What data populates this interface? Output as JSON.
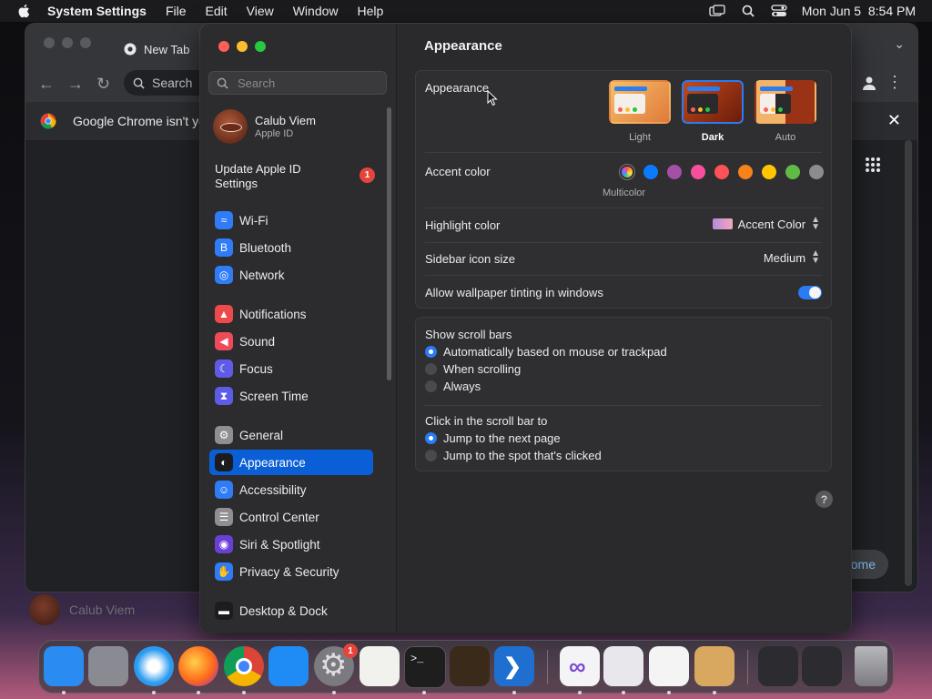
{
  "menubar": {
    "apple_icon": "apple-logo-icon",
    "app_name": "System Settings",
    "menus": [
      "File",
      "Edit",
      "View",
      "Window",
      "Help"
    ],
    "status_icons": [
      "display-mirror-icon",
      "search-icon",
      "control-center-icon"
    ],
    "clock": "Mon Jun 5  8:54 PM"
  },
  "chrome": {
    "tab_title": "New Tab",
    "omnibox_placeholder": "Search",
    "infobar_text": "Google Chrome isn't yo",
    "home_button": "ome",
    "profile_name": "Calub Viem"
  },
  "settings": {
    "search_placeholder": "Search",
    "account": {
      "name": "Calub Viem",
      "subtitle": "Apple ID"
    },
    "update": {
      "label": "Update Apple ID Settings",
      "badge": "1"
    },
    "sidebar": [
      {
        "label": "Wi-Fi",
        "icon": "wifi-icon",
        "color": "#2f7cf6"
      },
      {
        "label": "Bluetooth",
        "icon": "bluetooth-icon",
        "color": "#2f7cf6"
      },
      {
        "label": "Network",
        "icon": "globe-icon",
        "color": "#2f7cf6"
      },
      {
        "label": "Notifications",
        "icon": "bell-icon",
        "color": "#ee4a4a"
      },
      {
        "label": "Sound",
        "icon": "speaker-icon",
        "color": "#ee4a5a"
      },
      {
        "label": "Focus",
        "icon": "moon-icon",
        "color": "#5e5ce6"
      },
      {
        "label": "Screen Time",
        "icon": "hourglass-icon",
        "color": "#5e5ce6"
      },
      {
        "label": "General",
        "icon": "gear-icon",
        "color": "#8e8e93"
      },
      {
        "label": "Appearance",
        "icon": "appearance-icon",
        "color": "#1c1c1e"
      },
      {
        "label": "Accessibility",
        "icon": "accessibility-icon",
        "color": "#2f7cf6"
      },
      {
        "label": "Control Center",
        "icon": "control-center-icon",
        "color": "#8e8e93"
      },
      {
        "label": "Siri & Spotlight",
        "icon": "siri-icon",
        "color": "#6a3fd6"
      },
      {
        "label": "Privacy & Security",
        "icon": "hand-icon",
        "color": "#2f7cf6"
      },
      {
        "label": "Desktop & Dock",
        "icon": "dock-icon",
        "color": "#1c1c1e"
      }
    ],
    "active_item": "Appearance",
    "title": "Appearance",
    "appearance": {
      "label": "Appearance",
      "options": [
        {
          "label": "Light",
          "selected": false
        },
        {
          "label": "Dark",
          "selected": true
        },
        {
          "label": "Auto",
          "selected": false
        }
      ]
    },
    "accent": {
      "label": "Accent color",
      "selected_name": "Multicolor",
      "colors": [
        "multicolor",
        "#0a7aff",
        "#a550a7",
        "#f74f9e",
        "#ff5257",
        "#f7821b",
        "#ffc600",
        "#62ba46",
        "#8c8c8c"
      ]
    },
    "highlight": {
      "label": "Highlight color",
      "value": "Accent Color"
    },
    "sidebar_icon_size": {
      "label": "Sidebar icon size",
      "value": "Medium"
    },
    "wallpaper_tinting": {
      "label": "Allow wallpaper tinting in windows",
      "enabled": true
    },
    "scroll_bars": {
      "label": "Show scroll bars",
      "options": [
        {
          "label": "Automatically based on mouse or trackpad",
          "selected": true
        },
        {
          "label": "When scrolling",
          "selected": false
        },
        {
          "label": "Always",
          "selected": false
        }
      ]
    },
    "click_scroll": {
      "label": "Click in the scroll bar to",
      "options": [
        {
          "label": "Jump to the next page",
          "selected": true
        },
        {
          "label": "Jump to the spot that's clicked",
          "selected": false
        }
      ]
    },
    "help": "?"
  },
  "dock": {
    "apps": [
      {
        "name": "finder-icon",
        "color": "#2a8cf0"
      },
      {
        "name": "launchpad-icon",
        "color": "#8a8a92"
      },
      {
        "name": "safari-icon",
        "color": "#2a9af0"
      },
      {
        "name": "firefox-icon",
        "color": "#ff6a1a"
      },
      {
        "name": "chrome-icon",
        "color": "#f4f4f4"
      },
      {
        "name": "app-store-icon",
        "color": "#1f8bf5"
      },
      {
        "name": "system-settings-icon",
        "color": "#7a7a80",
        "badge": "1"
      },
      {
        "name": "textedit-icon",
        "color": "#f1f1ee"
      },
      {
        "name": "terminal-icon",
        "color": "#1e1e1e"
      },
      {
        "name": "garageband-icon",
        "color": "#3a2a1a"
      },
      {
        "name": "vscode-icon",
        "color": "#1f6fd0"
      },
      {
        "name": "visual-studio-icon",
        "color": "#7a4ad0"
      },
      {
        "name": "macos-installer-icon",
        "color": "#e8e8ec"
      },
      {
        "name": "freeform-icon",
        "color": "#f4f4f4"
      },
      {
        "name": "paint-palette-icon",
        "color": "#d8a860"
      },
      {
        "name": "downloads-stack-icon",
        "color": "#2c2c30"
      },
      {
        "name": "recent-stack-icon",
        "color": "#2c2c30"
      },
      {
        "name": "trash-icon",
        "color": "#6a6a70"
      }
    ]
  }
}
